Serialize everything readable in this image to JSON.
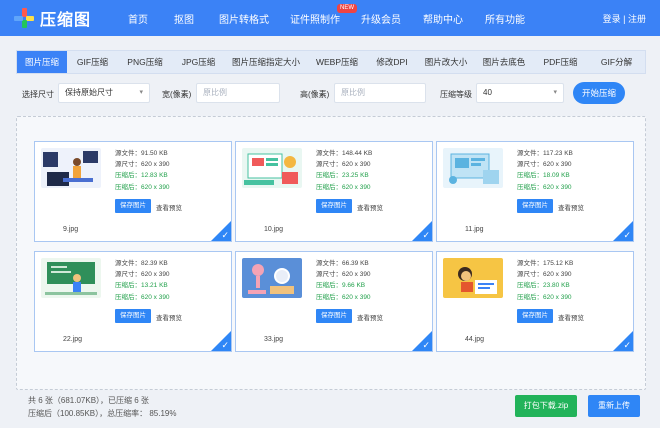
{
  "header": {
    "logo_text": "压缩图",
    "nav": [
      "首页",
      "抠图",
      "图片转格式",
      "证件照制作",
      "升级会员",
      "帮助中心",
      "所有功能"
    ],
    "new_badge": "NEW",
    "login": "登录",
    "register": "注册",
    "login_sep": "|"
  },
  "tabs": [
    "图片压缩",
    "GIF压缩",
    "PNG压缩",
    "JPG压缩",
    "图片压缩指定大小",
    "WEBP压缩",
    "修改DPI",
    "图片改大小",
    "图片去底色",
    "PDF压缩",
    "GIF分解"
  ],
  "options": {
    "size_label": "选择尺寸",
    "size_value": "保持原始尺寸",
    "width_label": "宽(像素)",
    "width_placeholder": "原比例",
    "height_label": "高(像素)",
    "height_placeholder": "原比例",
    "level_label": "压缩等级",
    "level_value": "40",
    "start_button": "开始压缩"
  },
  "cards": [
    {
      "file": "9.jpg",
      "src_file": "源文件：91.50 KB",
      "src_size": "源尺寸：620 x 390",
      "after": "压缩后：12.83 KB",
      "after_size": "压缩后：620 x 390",
      "save": "保存图片",
      "preview": "查看预览"
    },
    {
      "file": "10.jpg",
      "src_file": "源文件：148.44 KB",
      "src_size": "源尺寸：620 x 390",
      "after": "压缩后：23.25 KB",
      "after_size": "压缩后：620 x 390",
      "save": "保存图片",
      "preview": "查看预览"
    },
    {
      "file": "11.jpg",
      "src_file": "源文件：117.23 KB",
      "src_size": "源尺寸：620 x 390",
      "after": "压缩后：18.09 KB",
      "after_size": "压缩后：620 x 390",
      "save": "保存图片",
      "preview": "查看预览"
    },
    {
      "file": "22.jpg",
      "src_file": "源文件：82.39 KB",
      "src_size": "源尺寸：620 x 390",
      "after": "压缩后：13.21 KB",
      "after_size": "压缩后：620 x 390",
      "save": "保存图片",
      "preview": "查看预览"
    },
    {
      "file": "33.jpg",
      "src_file": "源文件：66.39 KB",
      "src_size": "源尺寸：620 x 390",
      "after": "压缩后：9.66 KB",
      "after_size": "压缩后：620 x 390",
      "save": "保存图片",
      "preview": "查看预览"
    },
    {
      "file": "44.jpg",
      "src_file": "源文件：175.12 KB",
      "src_size": "源尺寸：620 x 390",
      "after": "压缩后：23.80 KB",
      "after_size": "压缩后：620 x 390",
      "save": "保存图片",
      "preview": "查看预览"
    }
  ],
  "summary": {
    "line1": "共 6 张（681.07KB），已压缩 6 张",
    "line2": "压缩后（100.85KB），总压缩率：  85.19%"
  },
  "buttons": {
    "zip": "打包下载.zip",
    "reupload": "重新上传"
  },
  "icons": {
    "checkmark": "check-icon",
    "dropdown": "chevron-down-icon",
    "logo": "plus-cross-logo-icon"
  },
  "colors": {
    "primary": "#3b82f6",
    "green": "#22b35a",
    "new_badge": "#ef4444"
  }
}
